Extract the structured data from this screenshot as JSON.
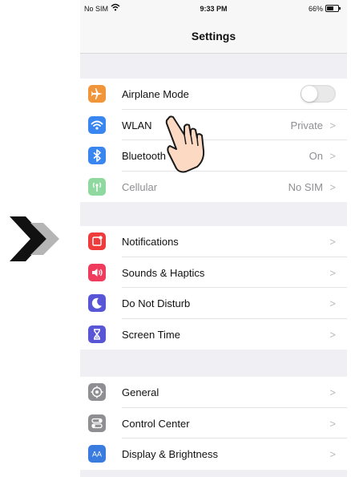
{
  "status_bar": {
    "carrier": "No SIM",
    "time": "9:33 PM",
    "battery": "66%"
  },
  "nav": {
    "title": "Settings"
  },
  "groups": [
    {
      "items": [
        {
          "label": "Airplane Mode",
          "icon": "airplane-icon",
          "color": "#f0953a",
          "control": "toggle",
          "toggle_on": false
        },
        {
          "label": "WLAN",
          "icon": "wifi-icon",
          "color": "#3a86f0",
          "value": "Private"
        },
        {
          "label": "Bluetooth",
          "icon": "bluetooth-icon",
          "color": "#3a86f0",
          "value": "On"
        },
        {
          "label": "Cellular",
          "icon": "cellular-icon",
          "color": "#8fd8a0",
          "value": "No SIM",
          "disabled": true
        }
      ]
    },
    {
      "items": [
        {
          "label": "Notifications",
          "icon": "notifications-icon",
          "color": "#ef3b3b"
        },
        {
          "label": "Sounds & Haptics",
          "icon": "sound-icon",
          "color": "#ef3b5c"
        },
        {
          "label": "Do Not Disturb",
          "icon": "moon-icon",
          "color": "#5856d6"
        },
        {
          "label": "Screen Time",
          "icon": "hourglass-icon",
          "color": "#5856d6"
        }
      ]
    },
    {
      "items": [
        {
          "label": "General",
          "icon": "gear-icon",
          "color": "#8e8e93"
        },
        {
          "label": "Control Center",
          "icon": "control-center-icon",
          "color": "#8e8e93"
        },
        {
          "label": "Display & Brightness",
          "icon": "display-icon",
          "color": "#3a7be0"
        }
      ]
    }
  ],
  "chevron": ">",
  "colors": {
    "page_bg": "#efeff4",
    "arrow_dark": "#111111",
    "arrow_light": "#b5b5b5",
    "hand_fill": "#fcd9c2"
  }
}
